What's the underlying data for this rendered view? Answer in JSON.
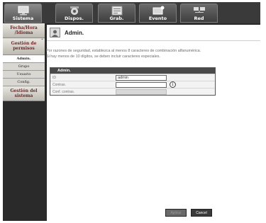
{
  "tabs": [
    {
      "label": "Sistema",
      "icon": "monitor-icon",
      "active": true
    },
    {
      "label": "Dispos.",
      "icon": "camera-icon",
      "active": false
    },
    {
      "label": "Grab.",
      "icon": "record-calendar-icon",
      "active": false
    },
    {
      "label": "Evento",
      "icon": "event-icon",
      "active": false
    },
    {
      "label": "Red",
      "icon": "network-icon",
      "active": false
    }
  ],
  "sidebar": {
    "section1": "Fecha/Hora /Idioma",
    "section2": "Gestión de permisos",
    "items": [
      "Admin.",
      "Grupo",
      "Usuario",
      "Config."
    ],
    "section3": "Gestión del sistema"
  },
  "main": {
    "title": "Admin.",
    "note_line1": "Por razones de seguridad, establezca al menos 8 caracteres de combinación alfanumérica.",
    "note_line2": "Si hay menos de 10 dígitos, se deben incluir caracteres especiales.",
    "table_header": "Admin.",
    "rows": [
      {
        "label": "ID",
        "value": "admin"
      },
      {
        "label": "Contras.",
        "value": ""
      },
      {
        "label": "Conf. contras.",
        "value": ""
      }
    ],
    "info_glyph": "i",
    "apply_label": "Aplicar",
    "cancel_label": "Cancel"
  }
}
